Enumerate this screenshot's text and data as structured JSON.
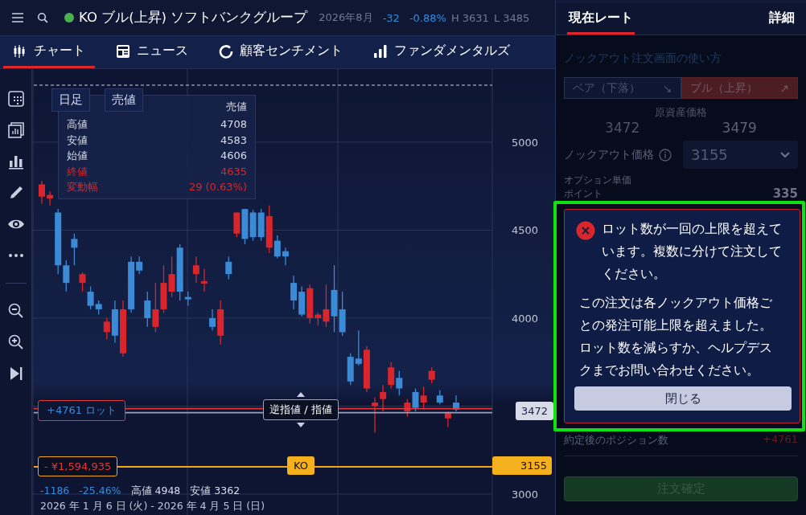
{
  "header": {
    "market_open": true,
    "title": "KO ブル(上昇) ソフトバンクグループ",
    "contract": "2026年8月",
    "change": "-32",
    "change_pct": "-0.88%",
    "high": "H 3631",
    "low": "L 3485"
  },
  "tabs": [
    {
      "label": "チャート",
      "kind": "candles",
      "selected": true
    },
    {
      "label": "ニュース",
      "kind": "news",
      "selected": false
    },
    {
      "label": "顧客センチメント",
      "kind": "sentiment",
      "selected": false
    },
    {
      "label": "ファンダメンタルズ",
      "kind": "fundamentals",
      "selected": false
    }
  ],
  "side_tabs": [
    {
      "label": "現在レート",
      "selected": true
    },
    {
      "label": "詳細",
      "selected": false
    }
  ],
  "chart": {
    "interval": "日足",
    "price_type": "売値",
    "tooltip": {
      "header": "売値",
      "rows": [
        {
          "label": "高値",
          "value": "4708",
          "highlight": false
        },
        {
          "label": "安値",
          "value": "4583",
          "highlight": false
        },
        {
          "label": "始値",
          "value": "4606",
          "highlight": false
        },
        {
          "label": "終値",
          "value": "4635",
          "highlight": true
        },
        {
          "label": "変動幅",
          "value": "29 (0.63%)",
          "highlight": true
        }
      ]
    },
    "chart_data": {
      "type": "candlestick",
      "ohlc": [
        [
          4690,
          4780,
          4650,
          4760
        ],
        [
          4680,
          4720,
          4640,
          4700
        ],
        [
          4600,
          4620,
          4250,
          4300
        ],
        [
          4300,
          4330,
          4150,
          4200
        ],
        [
          4450,
          4480,
          4300,
          4400
        ],
        [
          4200,
          4260,
          4150,
          4250
        ],
        [
          4150,
          4180,
          4050,
          4070
        ],
        [
          4080,
          4100,
          4020,
          4050
        ],
        [
          3920,
          4000,
          3880,
          3980
        ],
        [
          4050,
          4100,
          3860,
          3900
        ],
        [
          3800,
          4100,
          3780,
          4050
        ],
        [
          4320,
          4350,
          4030,
          4050
        ],
        [
          4320,
          4350,
          4250,
          4270
        ],
        [
          4100,
          4150,
          3950,
          4000
        ],
        [
          3950,
          4200,
          3920,
          4050
        ],
        [
          4050,
          4300,
          4030,
          4200
        ],
        [
          4150,
          4350,
          4120,
          4250
        ],
        [
          4400,
          4420,
          4100,
          4150
        ],
        [
          4120,
          4150,
          4070,
          4110
        ],
        [
          4250,
          4350,
          4200,
          4300
        ],
        [
          4200,
          4280,
          4150,
          4210
        ],
        [
          4000,
          4050,
          3930,
          3950
        ],
        [
          3900,
          4100,
          3850,
          4050
        ],
        [
          4320,
          4350,
          4220,
          4250
        ],
        [
          4480,
          4600,
          4460,
          4600
        ],
        [
          4620,
          4620,
          4420,
          4450
        ],
        [
          4600,
          4615,
          4440,
          4460
        ],
        [
          4600,
          4620,
          4440,
          4460
        ],
        [
          4400,
          4640,
          4370,
          4580
        ],
        [
          4440,
          4470,
          4340,
          4350
        ],
        [
          4380,
          4400,
          4300,
          4350
        ],
        [
          4200,
          4240,
          4050,
          4100
        ],
        [
          4150,
          4180,
          4010,
          4020
        ],
        [
          4000,
          4190,
          3970,
          4170
        ],
        [
          4000,
          4030,
          3960,
          4020
        ],
        [
          3980,
          4190,
          3950,
          4050
        ],
        [
          4160,
          4300,
          3920,
          4010
        ],
        [
          4050,
          4150,
          3900,
          3920
        ],
        [
          3780,
          3800,
          3620,
          3640
        ],
        [
          3770,
          3930,
          3730,
          3740
        ],
        [
          3600,
          3840,
          3580,
          3820
        ],
        [
          3500,
          3550,
          3350,
          3520
        ],
        [
          3540,
          3620,
          3470,
          3580
        ],
        [
          3620,
          3750,
          3600,
          3720
        ],
        [
          3660,
          3700,
          3560,
          3600
        ],
        [
          3470,
          3540,
          3440,
          3520
        ],
        [
          3580,
          3600,
          3470,
          3490
        ],
        [
          3520,
          3610,
          3480,
          3560
        ],
        [
          3650,
          3720,
          3630,
          3700
        ],
        [
          3560,
          3590,
          3510,
          3520
        ],
        [
          3430,
          3470,
          3380,
          3460
        ],
        [
          3520,
          3560,
          3470,
          3480
        ]
      ],
      "yticks": [
        5000,
        4500,
        4000,
        3000
      ],
      "ylim": [
        2881,
        5415
      ],
      "grid": true
    },
    "position_label": "+4761 ロット",
    "order_handle": "逆指値 / 指値",
    "current_price": "3472",
    "knockout": {
      "pnl": "- ¥1,594,935",
      "badge": "KO",
      "price": "3155"
    },
    "summary": {
      "change": "-1186",
      "change_pct": "-25.46%",
      "high": "高値 4948",
      "low": "安値 3362"
    },
    "range": "2026 年 1 月 6 日 (火) - 2026 年 4 月 5 日 (日)"
  },
  "order_panel": {
    "help_link": "ノックアウト注文画面の使い方",
    "direction": [
      {
        "label": "ベア（下落）",
        "arrow": "↘",
        "selected": false
      },
      {
        "label": "ブル（上昇）",
        "arrow": "↗",
        "selected": true
      }
    ],
    "underlying_label": "原資産価格",
    "bid": "3472",
    "ask": "3479",
    "ko_label": "ノックアウト価格",
    "ko_value": "3155",
    "option_label": "オプション単価",
    "points_label": "ポイント",
    "points_value": "335",
    "position_label": "約定後のポジション数",
    "position_value": "+4761",
    "submit": "注文確定"
  },
  "dialog": {
    "highlighted": true,
    "message": "ロット数が一回の上限を超えています。複数に分けて注文してください。",
    "detail": "この注文は各ノックアウト価格ごとの発注可能上限を超えました。ロット数を減らすか、ヘルプデスクまでお問い合わせください。",
    "close": "閉じる"
  }
}
